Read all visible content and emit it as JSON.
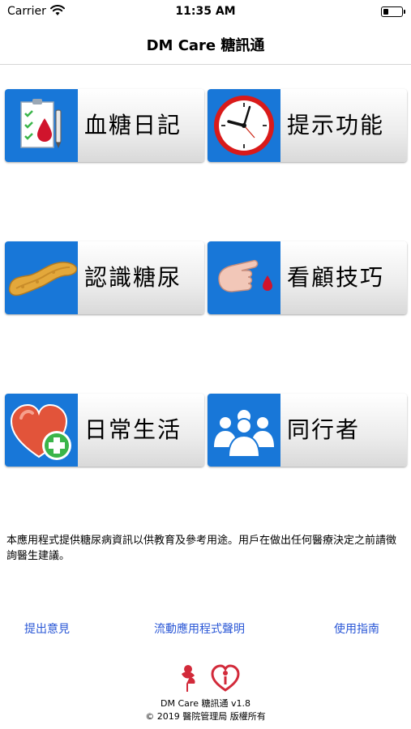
{
  "status_bar": {
    "carrier": "Carrier",
    "time": "11:35 AM"
  },
  "nav": {
    "title": "DM Care 糖訊通"
  },
  "menu": [
    {
      "label": "血糖日記",
      "icon": "blood-glucose-diary-icon"
    },
    {
      "label": "提示功能",
      "icon": "clock-icon"
    },
    {
      "label": "認識糖尿",
      "icon": "pancreas-icon"
    },
    {
      "label": "看顧技巧",
      "icon": "finger-blood-drop-icon"
    },
    {
      "label": "日常生活",
      "icon": "heart-plus-icon"
    },
    {
      "label": "同行者",
      "icon": "people-group-icon"
    }
  ],
  "disclaimer": "本應用程式提供糖尿病資訊以供教育及參考用途。用戶在做出任何醫療決定之前請徵詢醫生建議。",
  "footer": {
    "feedback": "提出意見",
    "statement": "流動應用程式聲明",
    "guide": "使用指南",
    "version": "DM Care 糖訊通 v1.8",
    "copyright": "© 2019 醫院管理局 版權所有"
  },
  "colors": {
    "tile_icon_bg": "#1877d8",
    "link": "#2a57d6"
  }
}
